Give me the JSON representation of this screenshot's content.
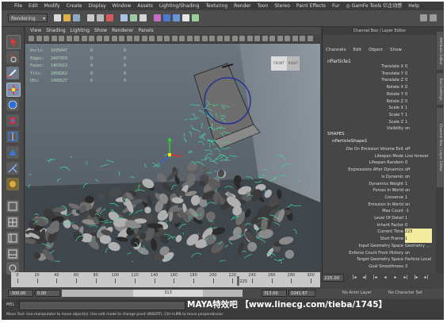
{
  "menubar": {
    "items": [
      "File",
      "Edit",
      "Modify",
      "Create",
      "Display",
      "Window",
      "Assets",
      "Lighting/Shading",
      "Texturing",
      "Render",
      "Toon",
      "Stereo",
      "Paint Effects",
      "Fur",
      "◎ GamFe Tools 亿企动感",
      "Help"
    ]
  },
  "shelf": {
    "mode": "Rendering"
  },
  "viewport": {
    "menu": [
      "View",
      "Shading",
      "Lighting",
      "Show",
      "Renderer",
      "Panels"
    ],
    "hud": [
      {
        "label": "Verts:",
        "value": "1035047",
        "a": "0",
        "b": "0"
      },
      {
        "label": "Edges:",
        "value": "2497959",
        "a": "0",
        "b": "0"
      },
      {
        "label": "Faces:",
        "value": "1463913",
        "a": "0",
        "b": "0"
      },
      {
        "label": "Tris:",
        "value": "2058262",
        "a": "0",
        "b": "0"
      },
      {
        "label": "UVs:",
        "value": "1496627",
        "a": "0",
        "b": "0"
      }
    ],
    "viewcube": {
      "front": "FRONT",
      "right": "RIGHT"
    }
  },
  "channel_box": {
    "title": "Channel Box / Layer Editor",
    "tabs": [
      "Channels",
      "Edit",
      "Object",
      "Show"
    ],
    "node": "nParticle1",
    "transform_attrs": [
      {
        "name": "Translate X",
        "value": "0"
      },
      {
        "name": "Translate Y",
        "value": "0"
      },
      {
        "name": "Translate Z",
        "value": "0"
      },
      {
        "name": "Rotate X",
        "value": "0"
      },
      {
        "name": "Rotate Y",
        "value": "0"
      },
      {
        "name": "Rotate Z",
        "value": "0"
      },
      {
        "name": "Scale X",
        "value": "1"
      },
      {
        "name": "Scale Y",
        "value": "1"
      },
      {
        "name": "Scale Z",
        "value": "1"
      },
      {
        "name": "Visibility",
        "value": "on"
      }
    ],
    "shapes_label": "SHAPES",
    "shape_node": "nParticleShape1",
    "shape_attrs": [
      {
        "name": "Die On Emission Volume Exit",
        "value": "off"
      },
      {
        "name": "Lifespan Mode",
        "value": "Live forever"
      },
      {
        "name": "Lifespan Random",
        "value": "0"
      },
      {
        "name": "Expressions After Dynamics",
        "value": "off"
      },
      {
        "name": "Is Dynamic",
        "value": "on"
      },
      {
        "name": "Dynamics Weight",
        "value": "1"
      },
      {
        "name": "Forces In World",
        "value": "on"
      },
      {
        "name": "Conserve",
        "value": "1"
      },
      {
        "name": "Emission In World",
        "value": "on"
      },
      {
        "name": "Max Count",
        "value": "-1"
      },
      {
        "name": "Level Of Detail",
        "value": "1"
      },
      {
        "name": "Inherit Factor",
        "value": "0"
      },
      {
        "name": "Current Time",
        "value": "225"
      },
      {
        "name": "Start Frame",
        "value": "1"
      },
      {
        "name": "Input Geometry Space",
        "value": "Geometry ..."
      },
      {
        "name": "Enforce Count From History",
        "value": "on"
      },
      {
        "name": "Target Geometry Space",
        "value": "Particle Local"
      },
      {
        "name": "Goal Smoothness",
        "value": "3"
      }
    ],
    "side_tabs": [
      "Attribute Editor",
      "Tool Settings",
      "Channel Box / Layer Editor"
    ]
  },
  "timeline": {
    "ticks": [
      "0",
      "20",
      "40",
      "60",
      "80",
      "100",
      "120",
      "140",
      "160",
      "180",
      "200",
      "220",
      "240",
      "260",
      "280",
      "300"
    ],
    "current_frame": "225",
    "time_field": "225.00"
  },
  "range": {
    "start": "-300.00",
    "inner_start": "0.00",
    "handle_label": "313",
    "end": "313.00",
    "outer_end": "1041.67",
    "anim_layer": "No Anim Layer",
    "char_set": "No Character Set"
  },
  "mel": {
    "label": "MEL",
    "watermark": "MAYA特效吧 【www.linecg.com/tieba/1745】"
  },
  "help": {
    "text": "Move Tool: Use manipulator to move object(s). Use edit mode to change pivot (INSERT). Ctrl+LMB to move perpendicular."
  }
}
